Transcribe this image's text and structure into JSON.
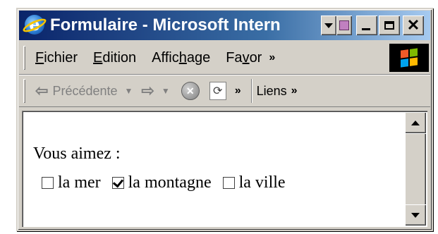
{
  "window": {
    "title": "Formulaire - Microsoft Intern"
  },
  "menubar": {
    "items": [
      {
        "label": "Fichier",
        "accel": "F",
        "rest": "ichier"
      },
      {
        "label": "Edition",
        "accel": "E",
        "rest": "dition"
      },
      {
        "label": "Affichage",
        "pre": "Affic",
        "accel": "h",
        "rest": "age"
      },
      {
        "label": "Favoris",
        "pre": "Fa",
        "accel": "v",
        "rest": "or"
      }
    ],
    "overflow": "»"
  },
  "toolbar": {
    "back_label": "Précédente",
    "overflow": "»",
    "links_label": "Liens",
    "links_overflow": "»"
  },
  "page": {
    "question": "Vous aimez :",
    "options": [
      {
        "label": "la mer",
        "checked": false
      },
      {
        "label": "la montagne",
        "checked": true
      },
      {
        "label": "la ville",
        "checked": false
      }
    ]
  },
  "icons": {
    "app": "ie-icon",
    "back": "back-arrow-icon",
    "forward": "forward-arrow-icon",
    "stop": "stop-icon",
    "refresh": "refresh-icon",
    "throbber": "windows-logo-icon"
  }
}
